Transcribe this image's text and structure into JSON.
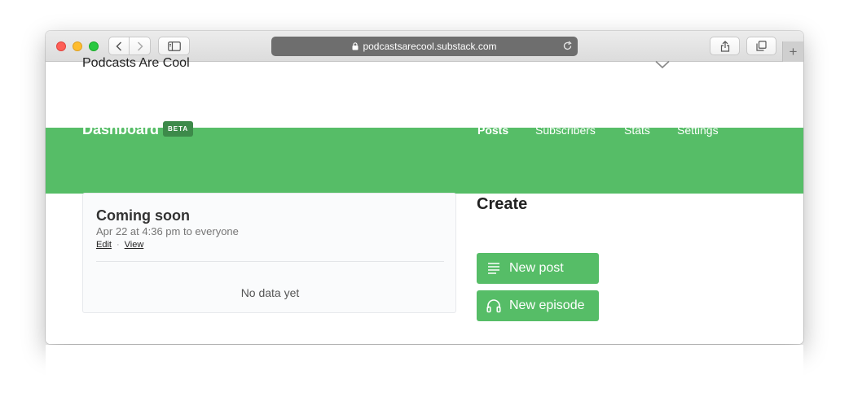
{
  "browser": {
    "url": "podcastsarecool.substack.com"
  },
  "site": {
    "title": "Podcasts Are Cool"
  },
  "dashboard": {
    "title": "Dashboard",
    "badge": "BETA",
    "nav": [
      {
        "label": "Posts",
        "active": true
      },
      {
        "label": "Subscribers",
        "active": false
      },
      {
        "label": "Stats",
        "active": false
      },
      {
        "label": "Settings",
        "active": false
      }
    ]
  },
  "post_card": {
    "title": "Coming soon",
    "meta": "Apr 22 at 4:36 pm to everyone",
    "edit_label": "Edit",
    "separator": "·",
    "view_label": "View",
    "empty_text": "No data yet"
  },
  "create": {
    "heading": "Create",
    "buttons": [
      {
        "label": "New post",
        "icon": "lines-icon"
      },
      {
        "label": "New episode",
        "icon": "headphones-icon"
      }
    ]
  },
  "colors": {
    "accent_green": "#56bd67",
    "badge_green": "#3d8a4a"
  }
}
